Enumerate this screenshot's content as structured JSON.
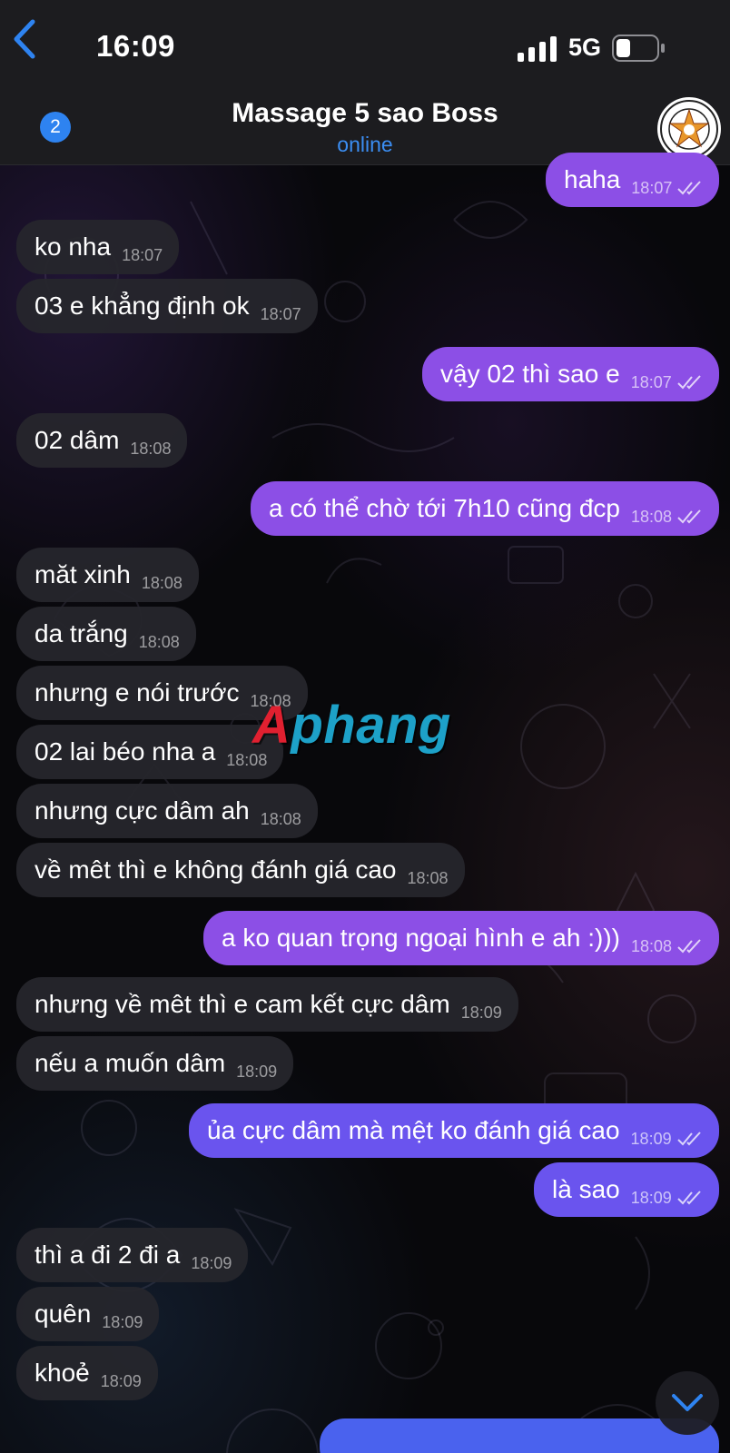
{
  "status_bar": {
    "time": "16:09",
    "network": "5G"
  },
  "header": {
    "back_count": "2",
    "title": "Massage 5 sao Boss",
    "status": "online"
  },
  "messages": [
    {
      "dir": "out",
      "text": "haha",
      "time": "18:07"
    },
    {
      "dir": "in",
      "text": "ko nha",
      "time": "18:07"
    },
    {
      "dir": "in",
      "text": "03 e khẳng định ok",
      "time": "18:07"
    },
    {
      "dir": "out",
      "text": "vậy 02 thì sao e",
      "time": "18:07"
    },
    {
      "dir": "in",
      "text": "02 dâm",
      "time": "18:08"
    },
    {
      "dir": "out",
      "text": "a có thể chờ tới 7h10 cũng đcp",
      "time": "18:08"
    },
    {
      "dir": "in",
      "text": "măt xinh",
      "time": "18:08"
    },
    {
      "dir": "in",
      "text": "da trắng",
      "time": "18:08"
    },
    {
      "dir": "in",
      "text": "nhưng e nói trước",
      "time": "18:08"
    },
    {
      "dir": "in",
      "text": "02 lai béo nha a",
      "time": "18:08"
    },
    {
      "dir": "in",
      "text": "nhưng cực dâm ah",
      "time": "18:08"
    },
    {
      "dir": "in",
      "text": "về mêt thì e không đánh giá cao",
      "time": "18:08"
    },
    {
      "dir": "out",
      "text": "a ko quan trọng ngoại hình e ah :)))",
      "time": "18:08"
    },
    {
      "dir": "in",
      "text": "nhưng về mêt thì e cam kết cực dâm",
      "time": "18:09"
    },
    {
      "dir": "in",
      "text": "nếu a muốn dâm",
      "time": "18:09"
    },
    {
      "dir": "out",
      "text": "ủa cực dâm mà mệt ko đánh giá cao",
      "time": "18:09"
    },
    {
      "dir": "out",
      "text": "là sao",
      "time": "18:09"
    },
    {
      "dir": "in",
      "text": "thì a đi 2 đi a",
      "time": "18:09"
    },
    {
      "dir": "in",
      "text": "quên",
      "time": "18:09"
    },
    {
      "dir": "in",
      "text": "khoẻ",
      "time": "18:09"
    }
  ],
  "watermark": {
    "first": "A",
    "rest": "phang"
  },
  "colors": {
    "outgoing": "#8c4fe6",
    "incoming": "#26262c",
    "accent": "#2e83f0"
  },
  "icons": {
    "back": "chevron-left-icon",
    "scroll": "chevron-down-icon",
    "read": "double-check-icon"
  }
}
